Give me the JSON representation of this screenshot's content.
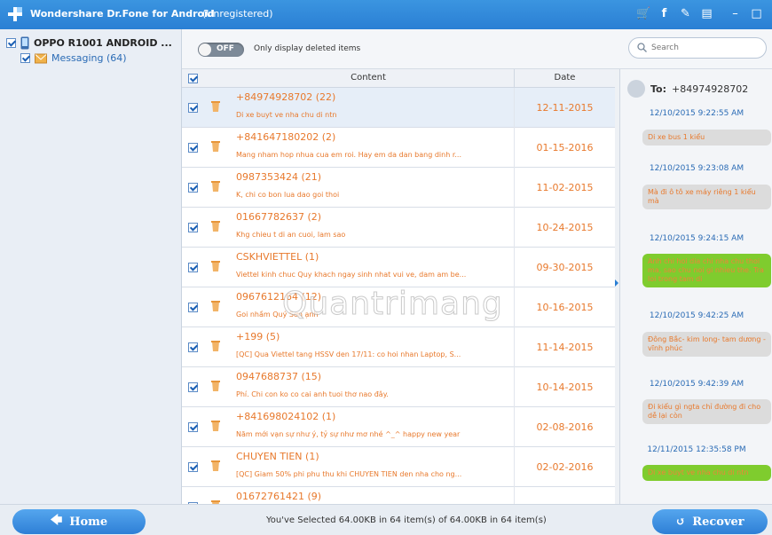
{
  "titlebar": {
    "app_title": "Wondershare Dr.Fone for Android",
    "registration": "(Unregistered)"
  },
  "sidebar": {
    "device": "OPPO R1001 ANDROID ...",
    "item": "Messaging (64)"
  },
  "toolbar": {
    "toggle_state": "OFF",
    "toggle_label": "Only display deleted items",
    "search_placeholder": "Search"
  },
  "list": {
    "col_content": "Content",
    "col_date": "Date",
    "rows": [
      {
        "number": "+84974928702 (22)",
        "message": "Di xe buyt ve nha chu di ntn",
        "date": "12-11-2015"
      },
      {
        "number": "+841647180202 (2)",
        "message": "Mang nham hop nhua cua em roi. Hay em da dan bang dinh r...",
        "date": "01-15-2016"
      },
      {
        "number": "0987353424 (21)",
        "message": "K, chi co bon lua dao goi thoi",
        "date": "11-02-2015"
      },
      {
        "number": "01667782637 (2)",
        "message": "Khg chieu t di an cuoi, lam sao",
        "date": "10-24-2015"
      },
      {
        "number": "CSKHVIETTEL (1)",
        "message": "Viettel kinh chuc Quy khach ngay sinh nhat vui ve, dam am be...",
        "date": "09-30-2015"
      },
      {
        "number": "0967612164 (12)",
        "message": "Goi nhầm Quý Sơn ạnh",
        "date": "10-16-2015"
      },
      {
        "number": "+199 (5)",
        "message": "[QC] Qua Viettel tang HSSV den 17/11: co hoi nhan Laptop, S...",
        "date": "11-14-2015"
      },
      {
        "number": "0947688737 (15)",
        "message": "Phí. Chi con ko co cai anh tuoi thơ nao đây.",
        "date": "10-14-2015"
      },
      {
        "number": "+841698024102 (1)",
        "message": "Năm mới vạn sự như ý, tỷ sự như mơ nhé ^_^ happy new year",
        "date": "02-08-2016"
      },
      {
        "number": "CHUYEN TIEN (1)",
        "message": "[QC] Giam 50% phi phu thu khi CHUYEN TIEN den nha cho ng...",
        "date": "02-02-2016"
      },
      {
        "number": "01672761421 (9)",
        "message": "",
        "date": ""
      }
    ]
  },
  "chat": {
    "to_label": "To:",
    "to_number": "+84974928702",
    "messages": [
      {
        "time": "12/10/2015 9:22:55 AM",
        "text": "Di xe bus 1 kiểu",
        "color": "#dcdcdc"
      },
      {
        "time": "12/10/2015 9:23:08 AM",
        "text": "Mà đi ô tô xe máy riêng 1 kiểu mà",
        "color": "#dcdcdc"
      },
      {
        "time": "12/10/2015 9:24:15 AM",
        "text": "Anh chi hoi dia chi nha chu thoi ma, sao chu noi gi nhieu the. Tra loi trong tam di",
        "color": "#7fcc2e"
      },
      {
        "time": "12/10/2015 9:42:25 AM",
        "text": "Đông Bắc- kim long- tam dương - vĩnh phúc",
        "color": "#dcdcdc"
      },
      {
        "time": "12/10/2015 9:42:39 AM",
        "text": "Đi kiểu gì ngta chỉ đường đi cho dễ lại còn",
        "color": "#dcdcdc"
      },
      {
        "time": "12/11/2015 12:35:58 PM",
        "text": "Di xe buyt ve nha chu di ntn",
        "color": "#7fcc2e"
      }
    ]
  },
  "bottom": {
    "home_label": "Home",
    "status": "You've Selected 64.00KB in 64 item(s) of 64.00KB in 64 item(s)",
    "recover_label": "Recover"
  },
  "watermark": "Quantrimang",
  "colors": {
    "accent": "#2a7fd4",
    "message_text": "#e8792c",
    "sent_bubble": "#7fcc2e"
  }
}
